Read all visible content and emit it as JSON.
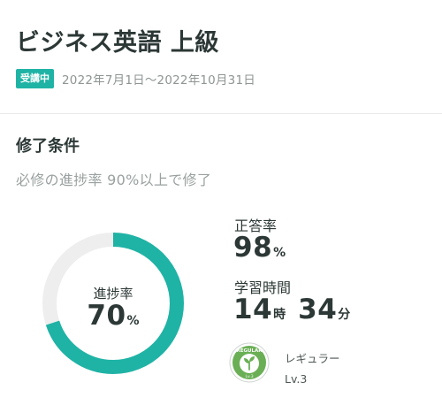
{
  "course": {
    "title": "ビジネス英語 上級",
    "status_badge": "受講中",
    "period": "2022年7月1日〜2022年10月31日"
  },
  "completion": {
    "section_title": "修了条件",
    "condition_text": "必修の進捗率 90%以上で修了",
    "progress_label": "進捗率",
    "progress_value": "70",
    "progress_unit": "%",
    "progress_fraction": 0.7
  },
  "stats": {
    "accuracy_label": "正答率",
    "accuracy_value": "98",
    "accuracy_unit": "%",
    "study_time_label": "学習時間",
    "hours_value": "14",
    "hours_unit": "時",
    "minutes_value": "34",
    "minutes_unit": "分"
  },
  "level": {
    "name": "レギュラー",
    "number": "Lv.3",
    "badge_text": "REGULAR",
    "badge_sub": "Lv.3"
  },
  "colors": {
    "accent": "#1fb3a5",
    "ring_track": "#eeeeee",
    "badge_green": "#6aaf55"
  }
}
